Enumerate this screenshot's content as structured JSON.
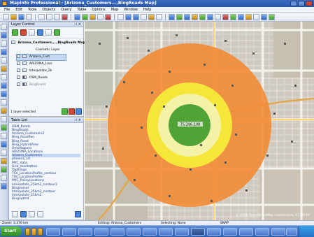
{
  "window": {
    "title": "MapInfo Professional - [Arizona_Customers...,BingRoads Map]"
  },
  "menu": [
    "File",
    "Edit",
    "Tools",
    "Objects",
    "Query",
    "Table",
    "Options",
    "Map",
    "Window",
    "Help"
  ],
  "layer_control": {
    "title": "Layer Control",
    "map_name": "Arizona_Customers,...,BingRoads Map",
    "layers": [
      "Cosmetic Layer",
      "Arizona_Cust",
      "ARIZONA_Loss",
      "Interpolate_2k",
      "OSM_Roads",
      "BingRoads"
    ],
    "status": "1 layer selected"
  },
  "table_list": {
    "title": "Table List",
    "tables": [
      "OSM_Roads",
      "BingRoads",
      "Arizona_Customers2",
      "Bing_RoadRen",
      "Bing_Road",
      "Bing_HybridView",
      "OmeRegions",
      "ARIZONA_Locations",
      "Arizona_Customers",
      "phoenix_10",
      "MYC_data",
      "Grid_manhattan",
      "Tapfilings",
      "TSV_LocationProfile_contour",
      "TSV_LocationProfile",
      "MYC_PolicyLocations",
      "Interpolate_25km2_contour2",
      "Bingsessel",
      "Interpolate_25km2_contour",
      "Interpolate_25km2",
      "Bingnybrid"
    ]
  },
  "map": {
    "center_label": "75,396.108",
    "attribution": "© 2008 OpenStreetMap contributors, CC-BY-SA"
  },
  "status_bar": {
    "zoom": "Zoom: 3.370 km",
    "editing": "Editing: Arizona_Customers",
    "selecting": "Selecting: None",
    "snap": "SNAP"
  },
  "taskbar": {
    "start_label": "Start"
  },
  "colors": {
    "outer_ring": "#f28c38",
    "middle_ring": "#f7e63a",
    "inner_circle": "#4fa337",
    "title_blue": "#2a55a8"
  }
}
